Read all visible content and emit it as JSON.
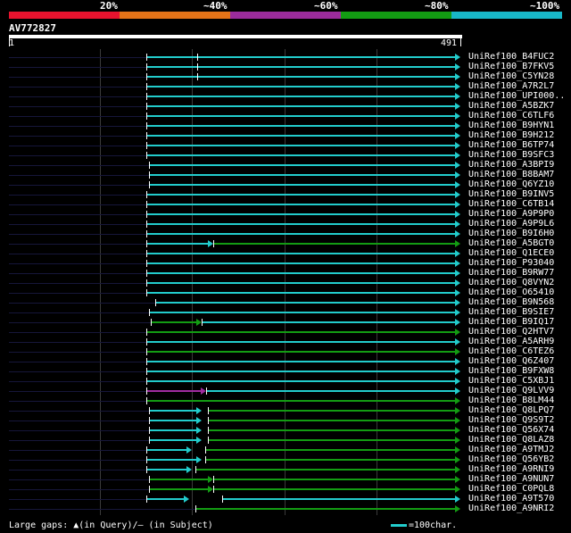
{
  "header": {
    "legend_labels": [
      "20%",
      "~40%",
      "~60%",
      "~80%",
      "~100%"
    ],
    "legend_colors": [
      "#e8132e",
      "#e37318",
      "#9c2c9c",
      "#139c13",
      "#18b8c8"
    ]
  },
  "query": {
    "id": "AV772827",
    "start": "1",
    "end": "491",
    "length": 491
  },
  "footer": {
    "gaps_text": "Large gaps: ▲(in Query)/– (in Subject)",
    "scale_text": "=100char."
  },
  "colors": {
    "cyan": "#2cc",
    "green": "#139c13",
    "purple": "#a02ca0",
    "guide": "#16163a"
  },
  "hits": [
    {
      "name": "UniRef100_B4FUC2",
      "segments": [
        {
          "start": 150,
          "end": 491,
          "color": "cyan"
        }
      ],
      "marks": [
        205
      ]
    },
    {
      "name": "UniRef100_B7FKV5",
      "segments": [
        {
          "start": 150,
          "end": 491,
          "color": "cyan"
        }
      ],
      "marks": [
        205
      ]
    },
    {
      "name": "UniRef100_C5YN28",
      "segments": [
        {
          "start": 150,
          "end": 491,
          "color": "cyan"
        }
      ],
      "marks": [
        205
      ]
    },
    {
      "name": "UniRef100_A7R2L7",
      "segments": [
        {
          "start": 150,
          "end": 491,
          "color": "cyan"
        }
      ],
      "marks": []
    },
    {
      "name": "UniRef100_UPI000..",
      "segments": [
        {
          "start": 150,
          "end": 491,
          "color": "cyan"
        }
      ],
      "marks": []
    },
    {
      "name": "UniRef100_A5BZK7",
      "segments": [
        {
          "start": 150,
          "end": 491,
          "color": "cyan"
        }
      ],
      "marks": []
    },
    {
      "name": "UniRef100_C6TLF6",
      "segments": [
        {
          "start": 150,
          "end": 491,
          "color": "cyan"
        }
      ],
      "marks": []
    },
    {
      "name": "UniRef100_B9HYN1",
      "segments": [
        {
          "start": 150,
          "end": 491,
          "color": "cyan"
        }
      ],
      "marks": []
    },
    {
      "name": "UniRef100_B9H212",
      "segments": [
        {
          "start": 150,
          "end": 491,
          "color": "cyan"
        }
      ],
      "marks": []
    },
    {
      "name": "UniRef100_B6TP74",
      "segments": [
        {
          "start": 150,
          "end": 491,
          "color": "cyan"
        }
      ],
      "marks": []
    },
    {
      "name": "UniRef100_B9SFC3",
      "segments": [
        {
          "start": 150,
          "end": 491,
          "color": "cyan"
        }
      ],
      "marks": []
    },
    {
      "name": "UniRef100_A3BPI9",
      "segments": [
        {
          "start": 153,
          "end": 491,
          "color": "cyan"
        }
      ],
      "marks": []
    },
    {
      "name": "UniRef100_B8BAM7",
      "segments": [
        {
          "start": 153,
          "end": 491,
          "color": "cyan"
        }
      ],
      "marks": []
    },
    {
      "name": "UniRef100_Q6YZ10",
      "segments": [
        {
          "start": 153,
          "end": 491,
          "color": "cyan"
        }
      ],
      "marks": []
    },
    {
      "name": "UniRef100_B9INV5",
      "segments": [
        {
          "start": 150,
          "end": 491,
          "color": "cyan"
        }
      ],
      "marks": []
    },
    {
      "name": "UniRef100_C6TB14",
      "segments": [
        {
          "start": 150,
          "end": 491,
          "color": "cyan"
        }
      ],
      "marks": []
    },
    {
      "name": "UniRef100_A9P9P0",
      "segments": [
        {
          "start": 150,
          "end": 491,
          "color": "cyan"
        }
      ],
      "marks": []
    },
    {
      "name": "UniRef100_A9P9L6",
      "segments": [
        {
          "start": 150,
          "end": 491,
          "color": "cyan"
        }
      ],
      "marks": []
    },
    {
      "name": "UniRef100_B9I6H0",
      "segments": [
        {
          "start": 150,
          "end": 491,
          "color": "cyan"
        }
      ],
      "marks": []
    },
    {
      "name": "UniRef100_A5BGT0",
      "segments": [
        {
          "start": 150,
          "end": 223,
          "color": "cyan"
        },
        {
          "start": 223,
          "end": 491,
          "color": "green"
        }
      ],
      "marks": []
    },
    {
      "name": "UniRef100_Q1ECE0",
      "segments": [
        {
          "start": 150,
          "end": 491,
          "color": "cyan"
        }
      ],
      "marks": []
    },
    {
      "name": "UniRef100_P93040",
      "segments": [
        {
          "start": 150,
          "end": 491,
          "color": "cyan"
        }
      ],
      "marks": []
    },
    {
      "name": "UniRef100_B9RW77",
      "segments": [
        {
          "start": 150,
          "end": 491,
          "color": "cyan"
        }
      ],
      "marks": []
    },
    {
      "name": "UniRef100_Q8VYN2",
      "segments": [
        {
          "start": 150,
          "end": 491,
          "color": "cyan"
        }
      ],
      "marks": []
    },
    {
      "name": "UniRef100_O65410",
      "segments": [
        {
          "start": 150,
          "end": 491,
          "color": "cyan"
        }
      ],
      "marks": []
    },
    {
      "name": "UniRef100_B9N568",
      "segments": [
        {
          "start": 160,
          "end": 491,
          "color": "cyan"
        }
      ],
      "marks": []
    },
    {
      "name": "UniRef100_B9SIE7",
      "segments": [
        {
          "start": 153,
          "end": 491,
          "color": "cyan"
        }
      ],
      "marks": []
    },
    {
      "name": "UniRef100_B9IQ17",
      "segments": [
        {
          "start": 155,
          "end": 210,
          "color": "green"
        },
        {
          "start": 210,
          "end": 491,
          "color": "cyan"
        }
      ],
      "marks": []
    },
    {
      "name": "UniRef100_Q2HTV7",
      "segments": [
        {
          "start": 150,
          "end": 491,
          "color": "green"
        }
      ],
      "marks": []
    },
    {
      "name": "UniRef100_A5ARH9",
      "segments": [
        {
          "start": 150,
          "end": 491,
          "color": "cyan"
        }
      ],
      "marks": []
    },
    {
      "name": "UniRef100_C6TEZ6",
      "segments": [
        {
          "start": 150,
          "end": 491,
          "color": "green"
        }
      ],
      "marks": []
    },
    {
      "name": "UniRef100_Q6Z407",
      "segments": [
        {
          "start": 150,
          "end": 491,
          "color": "cyan"
        }
      ],
      "marks": []
    },
    {
      "name": "UniRef100_B9FXW8",
      "segments": [
        {
          "start": 150,
          "end": 491,
          "color": "cyan"
        }
      ],
      "marks": []
    },
    {
      "name": "UniRef100_C5XBJ1",
      "segments": [
        {
          "start": 150,
          "end": 491,
          "color": "cyan"
        }
      ],
      "marks": []
    },
    {
      "name": "UniRef100_Q9LVV9",
      "segments": [
        {
          "start": 150,
          "end": 215,
          "color": "purple"
        },
        {
          "start": 215,
          "end": 491,
          "color": "cyan"
        }
      ],
      "marks": []
    },
    {
      "name": "UniRef100_B8LM44",
      "segments": [
        {
          "start": 150,
          "end": 491,
          "color": "green"
        }
      ],
      "marks": []
    },
    {
      "name": "UniRef100_Q8LPQ7",
      "segments": [
        {
          "start": 153,
          "end": 210,
          "color": "cyan"
        },
        {
          "start": 217,
          "end": 491,
          "color": "green"
        }
      ],
      "marks": []
    },
    {
      "name": "UniRef100_Q9S9T2",
      "segments": [
        {
          "start": 153,
          "end": 210,
          "color": "cyan"
        },
        {
          "start": 217,
          "end": 491,
          "color": "green"
        }
      ],
      "marks": []
    },
    {
      "name": "UniRef100_Q56X74",
      "segments": [
        {
          "start": 153,
          "end": 210,
          "color": "cyan"
        },
        {
          "start": 217,
          "end": 491,
          "color": "green"
        }
      ],
      "marks": []
    },
    {
      "name": "UniRef100_Q8LAZ8",
      "segments": [
        {
          "start": 153,
          "end": 210,
          "color": "cyan"
        },
        {
          "start": 217,
          "end": 491,
          "color": "green"
        }
      ],
      "marks": []
    },
    {
      "name": "UniRef100_A9TMJ2",
      "segments": [
        {
          "start": 150,
          "end": 200,
          "color": "cyan"
        },
        {
          "start": 214,
          "end": 491,
          "color": "green"
        }
      ],
      "marks": []
    },
    {
      "name": "UniRef100_Q56YB2",
      "segments": [
        {
          "start": 150,
          "end": 210,
          "color": "cyan"
        },
        {
          "start": 214,
          "end": 491,
          "color": "green"
        }
      ],
      "marks": []
    },
    {
      "name": "UniRef100_A9RNI9",
      "segments": [
        {
          "start": 150,
          "end": 200,
          "color": "cyan"
        },
        {
          "start": 203,
          "end": 491,
          "color": "green"
        }
      ],
      "marks": []
    },
    {
      "name": "UniRef100_A9NUN7",
      "segments": [
        {
          "start": 153,
          "end": 223,
          "color": "green"
        },
        {
          "start": 223,
          "end": 491,
          "color": "green"
        }
      ],
      "marks": []
    },
    {
      "name": "UniRef100_C0PQL8",
      "segments": [
        {
          "start": 153,
          "end": 223,
          "color": "green"
        },
        {
          "start": 223,
          "end": 491,
          "color": "green"
        }
      ],
      "marks": []
    },
    {
      "name": "UniRef100_A9T570",
      "segments": [
        {
          "start": 150,
          "end": 197,
          "color": "cyan"
        },
        {
          "start": 232,
          "end": 491,
          "color": "cyan"
        }
      ],
      "marks": []
    },
    {
      "name": "UniRef100_A9NRI2",
      "segments": [
        {
          "start": 203,
          "end": 491,
          "color": "green"
        }
      ],
      "marks": []
    }
  ]
}
